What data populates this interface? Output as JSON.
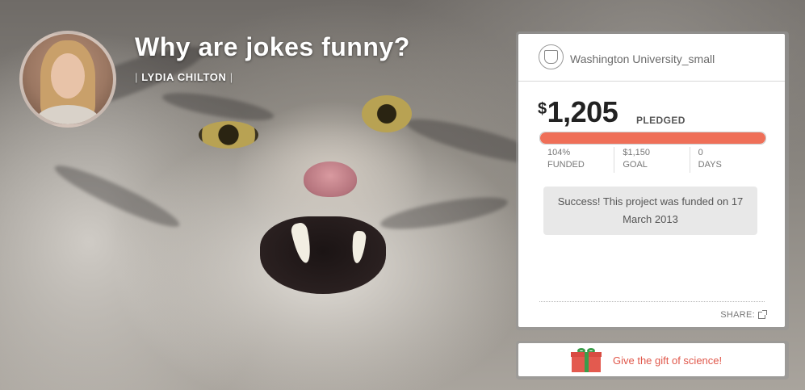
{
  "project": {
    "title": "Why are jokes funny?",
    "author": "LYDIA CHILTON"
  },
  "institution": {
    "name": "Washington University_small",
    "icon": "university-seal-icon"
  },
  "funding": {
    "currency": "$",
    "pledged": "1,205",
    "pledged_label": "PLEDGED",
    "progress_fraction": 1.0,
    "stats": [
      {
        "value": "104%",
        "label": "FUNDED"
      },
      {
        "value": "$1,150",
        "label": "GOAL"
      },
      {
        "value": "0",
        "label": "DAYS"
      }
    ],
    "success_message": "Success! This project was funded on 17 March 2013"
  },
  "share": {
    "label": "SHARE:",
    "icon": "share-icon"
  },
  "gift": {
    "label": "Give the gift of science!",
    "icon": "gift-icon"
  },
  "colors": {
    "progress": "#ef6f58",
    "gift_text": "#e0574a",
    "ribbon": "#3a9d4b"
  }
}
